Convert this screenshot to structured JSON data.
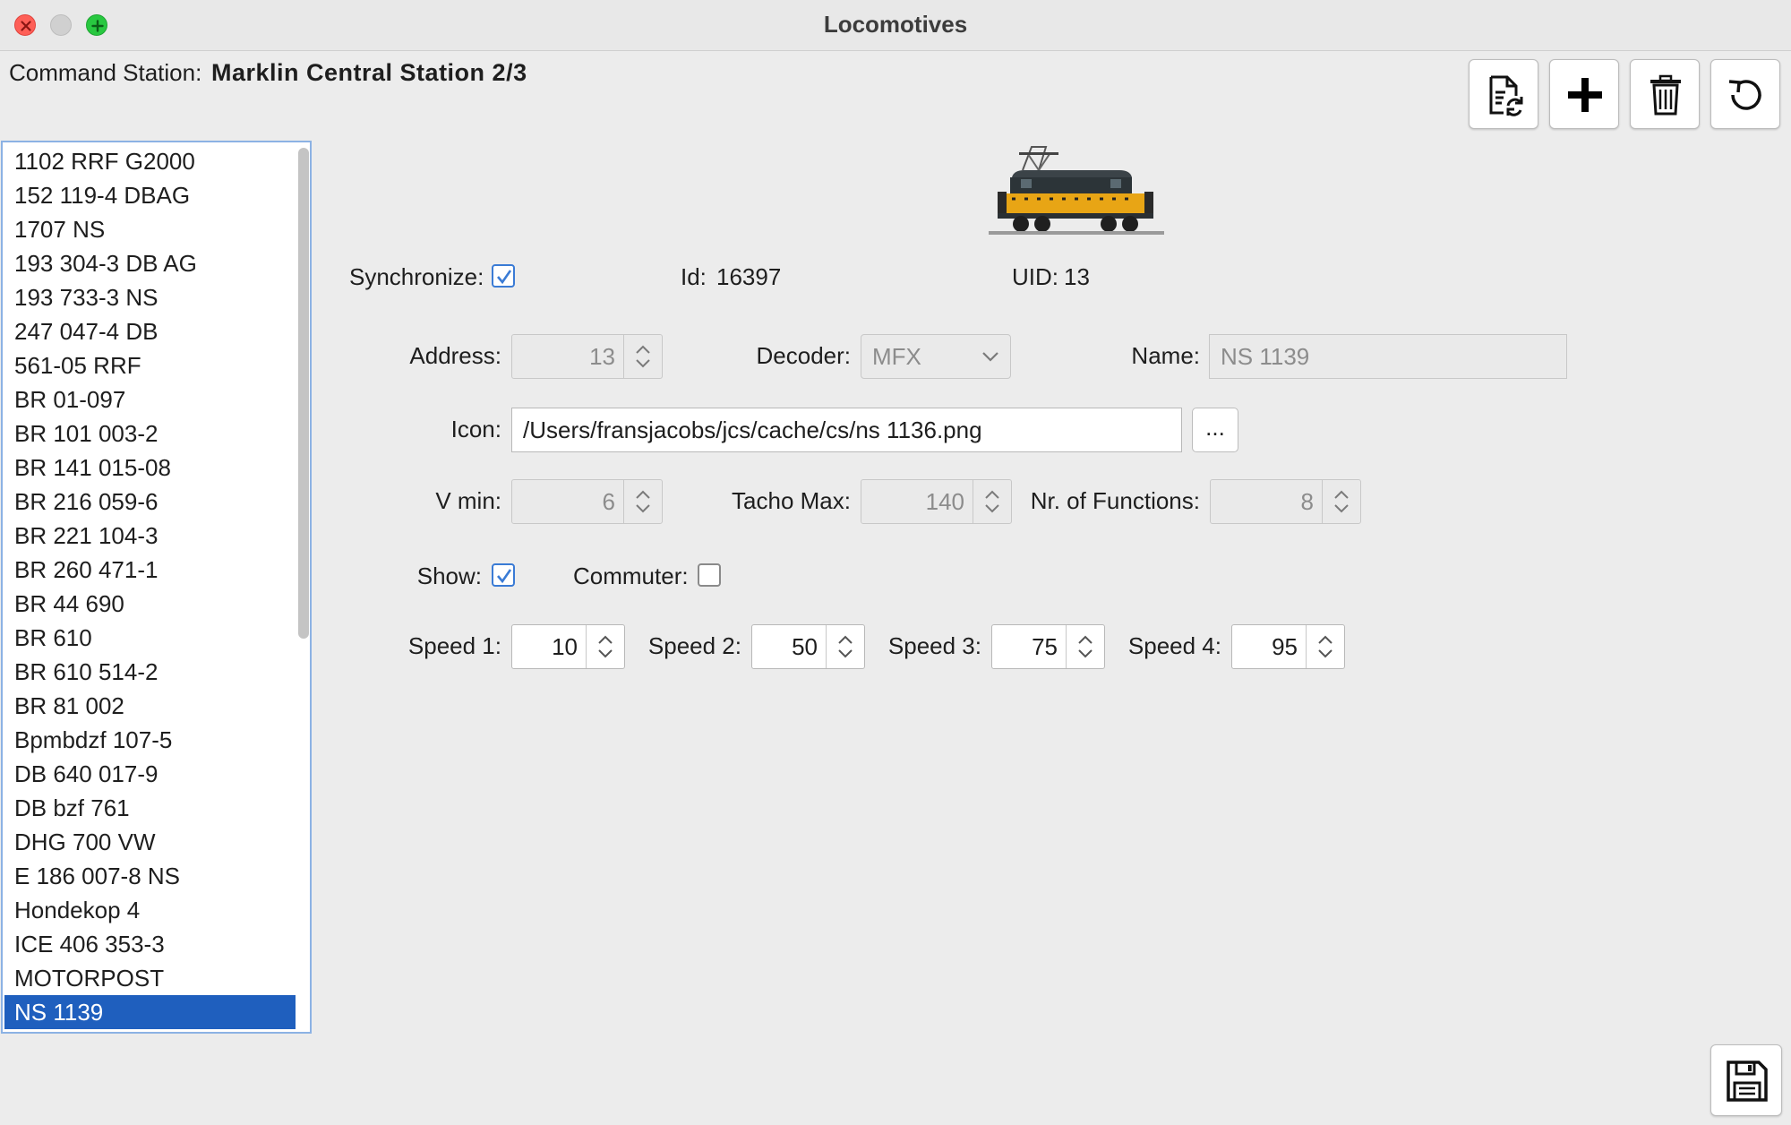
{
  "window": {
    "title": "Locomotives"
  },
  "command_station": {
    "label": "Command Station:",
    "value": "Marklin Central Station 2/3"
  },
  "toolbar": {
    "sync_icon": "document-sync-icon",
    "add_icon": "plus-icon",
    "delete_icon": "trash-icon",
    "refresh_icon": "refresh-icon"
  },
  "locomotive_list": {
    "items": [
      "1102 RRF G2000",
      "152 119-4 DBAG",
      "1707 NS",
      "193 304-3 DB AG",
      "193 733-3 NS",
      "247 047-4 DB",
      "561-05 RRF",
      "BR 01-097",
      "BR 101 003-2",
      "BR 141 015-08",
      "BR 216 059-6",
      "BR 221 104-3",
      "BR 260 471-1",
      "BR 44 690",
      "BR 610",
      "BR 610 514-2",
      "BR 81 002",
      "Bpmbdzf 107-5",
      "DB 640 017-9",
      "DB bzf 761",
      "DHG 700 VW",
      "E 186 007-8 NS",
      "Hondekop 4",
      "ICE 406 353-3",
      "MOTORPOST",
      "NS 1139"
    ],
    "selected": "NS 1139"
  },
  "details": {
    "synchronize_label": "Synchronize:",
    "synchronize_checked": true,
    "id_label": "Id:",
    "id_value": "16397",
    "uid_label": "UID:",
    "uid_value": "13",
    "address_label": "Address:",
    "address_value": "13",
    "decoder_label": "Decoder:",
    "decoder_value": "MFX",
    "name_label": "Name:",
    "name_value": "NS 1139",
    "icon_label": "Icon:",
    "icon_value": "/Users/fransjacobs/jcs/cache/cs/ns 1136.png",
    "browse_label": "...",
    "vmin_label": "V min:",
    "vmin_value": "6",
    "tacho_label": "Tacho Max:",
    "tacho_value": "140",
    "functions_label": "Nr. of Functions:",
    "functions_value": "8",
    "show_label": "Show:",
    "show_checked": true,
    "commuter_label": "Commuter:",
    "commuter_checked": false,
    "speed1_label": "Speed 1:",
    "speed1_value": "10",
    "speed2_label": "Speed 2:",
    "speed2_value": "50",
    "speed3_label": "Speed 3:",
    "speed3_value": "75",
    "speed4_label": "Speed 4:",
    "speed4_value": "95"
  },
  "save_icon": "floppy-disk-icon",
  "colors": {
    "selection": "#1f5fbe",
    "checkbox": "#3a7bd5",
    "window_bg": "#ececec"
  }
}
